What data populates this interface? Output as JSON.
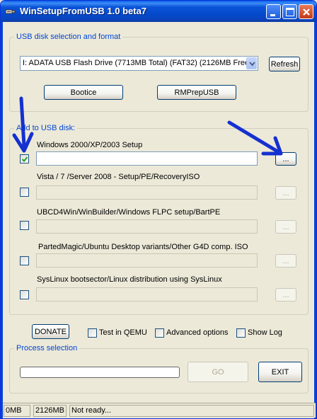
{
  "window": {
    "title": "WinSetupFromUSB 1.0 beta7"
  },
  "usb_group": {
    "legend": "USB disk selection and format",
    "disk_selected": "I: ADATA USB Flash Drive (7713MB Total) (FAT32) (2126MB Free",
    "refresh_label": "Refresh",
    "bootice_label": "Bootice",
    "rmprep_label": "RMPrepUSB"
  },
  "add_group": {
    "legend": "Add to USB disk:",
    "sources": [
      {
        "label": "Windows 2000/XP/2003 Setup",
        "checked": true,
        "browse": "...",
        "enabled": true
      },
      {
        "label": "Vista / 7 /Server 2008 - Setup/PE/RecoveryISO",
        "checked": false,
        "browse": "...",
        "enabled": false
      },
      {
        "label": "UBCD4Win/WinBuilder/Windows FLPC setup/BartPE",
        "checked": false,
        "browse": "...",
        "enabled": false
      },
      {
        "label": "PartedMagic/Ubuntu Desktop variants/Other G4D comp. ISO",
        "checked": false,
        "browse": "...",
        "enabled": false
      },
      {
        "label": "SysLinux bootsector/Linux distribution using SysLinux",
        "checked": false,
        "browse": "...",
        "enabled": false
      }
    ]
  },
  "options": {
    "donate_label": "DONATE",
    "test_qemu": "Test in QEMU",
    "advanced": "Advanced options",
    "show_log": "Show Log"
  },
  "process_group": {
    "legend": "Process selection",
    "progress_fraction": 0,
    "go_label": "GO",
    "exit_label": "EXIT"
  },
  "status": {
    "cell1": "0MB",
    "cell2": "2126MB",
    "cell3": "Not ready..."
  },
  "colors": {
    "annotation_arrow": "#1530d0",
    "legend_text": "#0046d5",
    "title_bar": "#0a53d8"
  }
}
